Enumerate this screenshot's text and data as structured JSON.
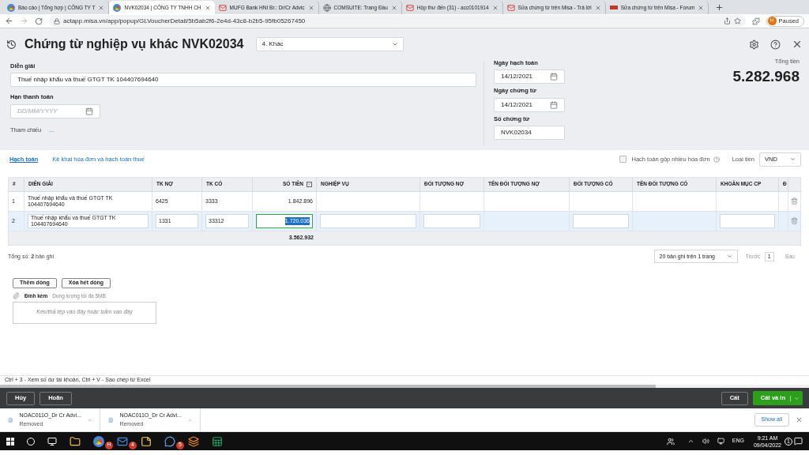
{
  "browser": {
    "tabs": [
      {
        "title": "Báo cáo | Tổng hợp | CÔNG TY T",
        "kind": "misa",
        "selected": false
      },
      {
        "title": "NVK02034 | CÔNG TY TNHH CH",
        "kind": "misa",
        "selected": true
      },
      {
        "title": "MUFG Bank HNI Br.: Dr/Cr Advic",
        "kind": "mail",
        "selected": false
      },
      {
        "title": "COMSUITE: Trang Đầu",
        "kind": "globe",
        "selected": false
      },
      {
        "title": "Hộp thư đến (31) - acc0101914",
        "kind": "mail",
        "selected": false
      },
      {
        "title": "Sửa chứng từ trên Misa - Trả lời",
        "kind": "mail",
        "selected": false
      },
      {
        "title": "Sửa chứng từ trên Misa - Forum",
        "kind": "forum",
        "selected": false
      }
    ],
    "url": "actapp.misa.vn/app/popup/GLVoucherDetail/5b5ab2f6-2e4d-43c8-b2b5-95fb05267450",
    "profile_initial": "H",
    "profile_status": "Paused"
  },
  "voucher": {
    "title": "Chứng từ nghiệp vụ khác NVK02034",
    "type": "4. Khác",
    "description_label": "Diễn giải",
    "description": "Thuế nhập khẩu và thuế GTGT TK 104407694640",
    "due_label": "Hạn thanh toán",
    "due_placeholder": "DD/MM/YYYY",
    "reference_label": "Tham chiếu",
    "reference_link": "...",
    "posting_date_label": "Ngày hạch toán",
    "posting_date": "14/12/2021",
    "voucher_date_label": "Ngày chứng từ",
    "voucher_date": "14/12/2021",
    "voucher_no_label": "Số chứng từ",
    "voucher_no": "NVK02034",
    "total_label": "Tổng tiền",
    "total": "5.282.968"
  },
  "subtabs": [
    {
      "label": "Hạch toán",
      "selected": true
    },
    {
      "label": "Kê khai hóa đơn và hạch toán thuế",
      "selected": false
    }
  ],
  "merge_invoices": {
    "label": "Hạch toán gộp nhiều hóa đơn",
    "checked": false
  },
  "currency": {
    "label": "Loại tiền",
    "value": "VND"
  },
  "table": {
    "columns": [
      "#",
      "DIỄN GIẢI",
      "TK NỢ",
      "TK CÓ",
      "SỐ TIỀN",
      "NGHIỆP VỤ",
      "ĐỐI TƯỢNG NỢ",
      "TÊN ĐỐI TƯỢNG NỢ",
      "ĐỐI TƯỢNG CÓ",
      "TÊN ĐỐI TƯỢNG CÓ",
      "KHOẢN MỤC CP",
      "Đ"
    ],
    "rows": [
      {
        "cells": [
          "1",
          "Thuế nhập khẩu và thuế GTGT TK 104407694640",
          "6425",
          "3333",
          "1.842.896"
        ],
        "selected": false
      },
      {
        "cells": [
          "2",
          "Thuế nhập khẩu và thuế GTGT TK 104407694640",
          "1331",
          "33312",
          "1.720.036"
        ],
        "selected": true
      }
    ],
    "total": "3.562.932"
  },
  "record_count": "Tổng số: **2** bản ghi",
  "pagination": {
    "page_size": "20 bản ghi trên 1 trang",
    "prev": "Trước",
    "page": "1",
    "next": "Sau"
  },
  "buttons": [
    "Thêm dòng",
    "Xóa hết dòng"
  ],
  "attachment": {
    "label": "Đính kèm",
    "limit": "Dung lượng tối đa 5MB",
    "dropzone": "Kéo/thả tệp vào đây hoặc bấm vào đây"
  },
  "shortcut_hint": "Ctrl + 3 - Xem số dư tài khoản, Ctrl + V - Sao chép từ Excel",
  "actions": {
    "left": [
      "Hủy",
      "Hoãn"
    ],
    "save": "Cất",
    "save_print": "Cất và In"
  },
  "downloads": {
    "items": [
      {
        "name": "NOAC011O_Dr Cr Advi...",
        "status": "Removed"
      },
      {
        "name": "NOAC011O_Dr Cr Advi...",
        "status": "Removed"
      }
    ],
    "show_all": "Show all"
  },
  "taskbar": {
    "apps": [
      {
        "kind": "explorer"
      },
      {
        "kind": "chrome",
        "badge": "H"
      },
      {
        "kind": "mail",
        "badge": "4"
      },
      {
        "kind": "notes"
      },
      {
        "kind": "chat",
        "badge": "5"
      },
      {
        "kind": "orange"
      },
      {
        "kind": "excel"
      }
    ],
    "language": "ENG",
    "time": "9:21 AM",
    "date": "09/04/2022",
    "notifications": "1"
  }
}
